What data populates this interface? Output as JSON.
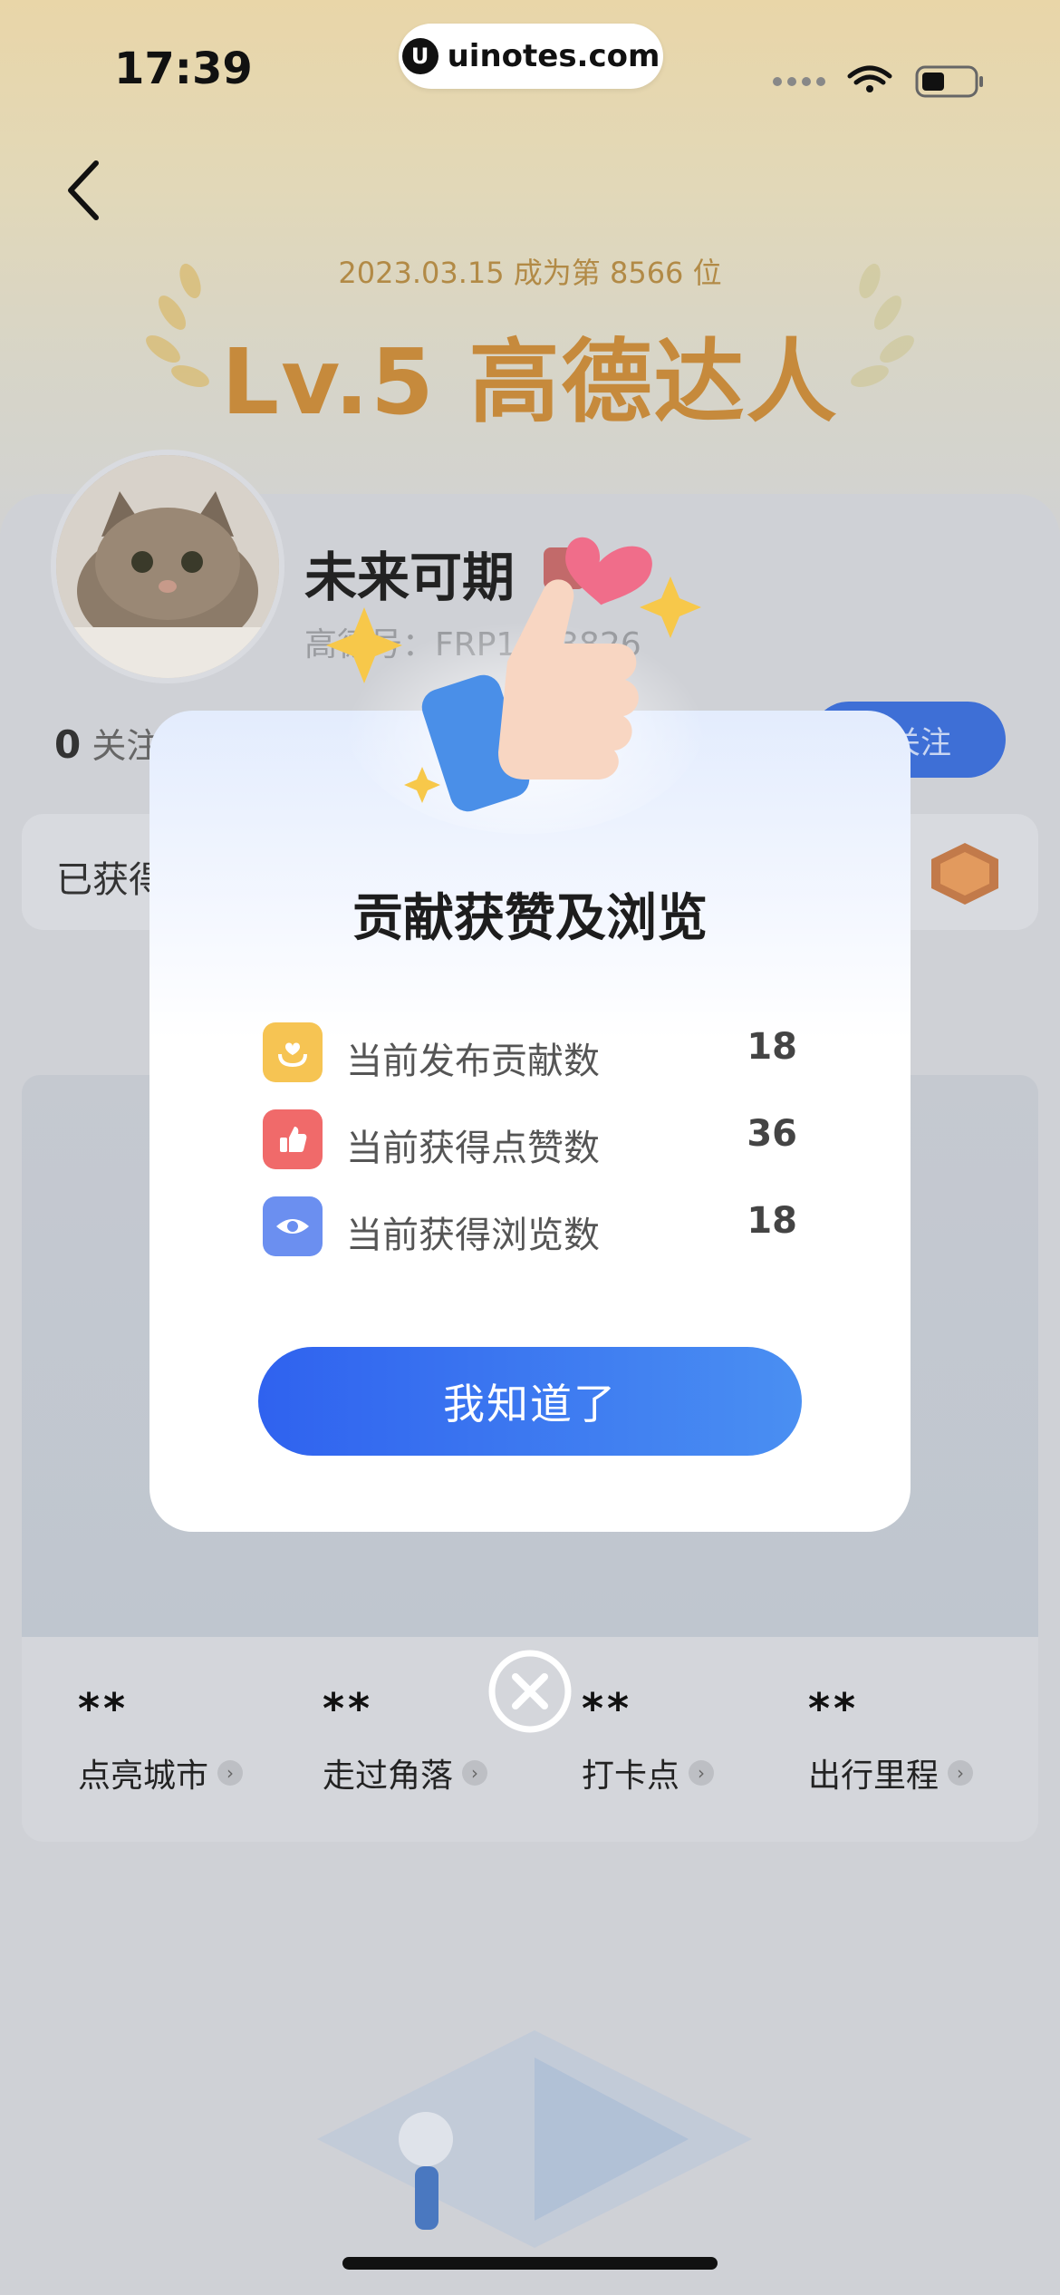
{
  "status_bar": {
    "time": "17:39",
    "url": "uinotes.com"
  },
  "header": {
    "level_date": "2023.03.15 成为第 8566 位",
    "level_title": "Lv.5 高德达人"
  },
  "profile": {
    "username": "未来可期",
    "id_text": "高德号：FRP1033826",
    "follow_count": "0",
    "follow_label": "关注",
    "follow_button": "关注",
    "earned_label": "已获得"
  },
  "stats": [
    {
      "value": "**",
      "label": "点亮城市"
    },
    {
      "value": "**",
      "label": "走过角落"
    },
    {
      "value": "**",
      "label": "打卡点"
    },
    {
      "value": "**",
      "label": "出行里程"
    }
  ],
  "dialog": {
    "title": "贡献获赞及浏览",
    "rows": [
      {
        "label": "当前发布贡献数",
        "value": "18",
        "icon": "hands-heart-icon",
        "color": "#f6c453"
      },
      {
        "label": "当前获得点赞数",
        "value": "36",
        "icon": "thumbs-up-icon",
        "color": "#f06a6a"
      },
      {
        "label": "当前获得浏览数",
        "value": "18",
        "icon": "eye-icon",
        "color": "#6b8ff0"
      }
    ],
    "ok_button": "我知道了"
  },
  "colors": {
    "primary": "#2f62ef",
    "gold": "#c68a3c"
  }
}
